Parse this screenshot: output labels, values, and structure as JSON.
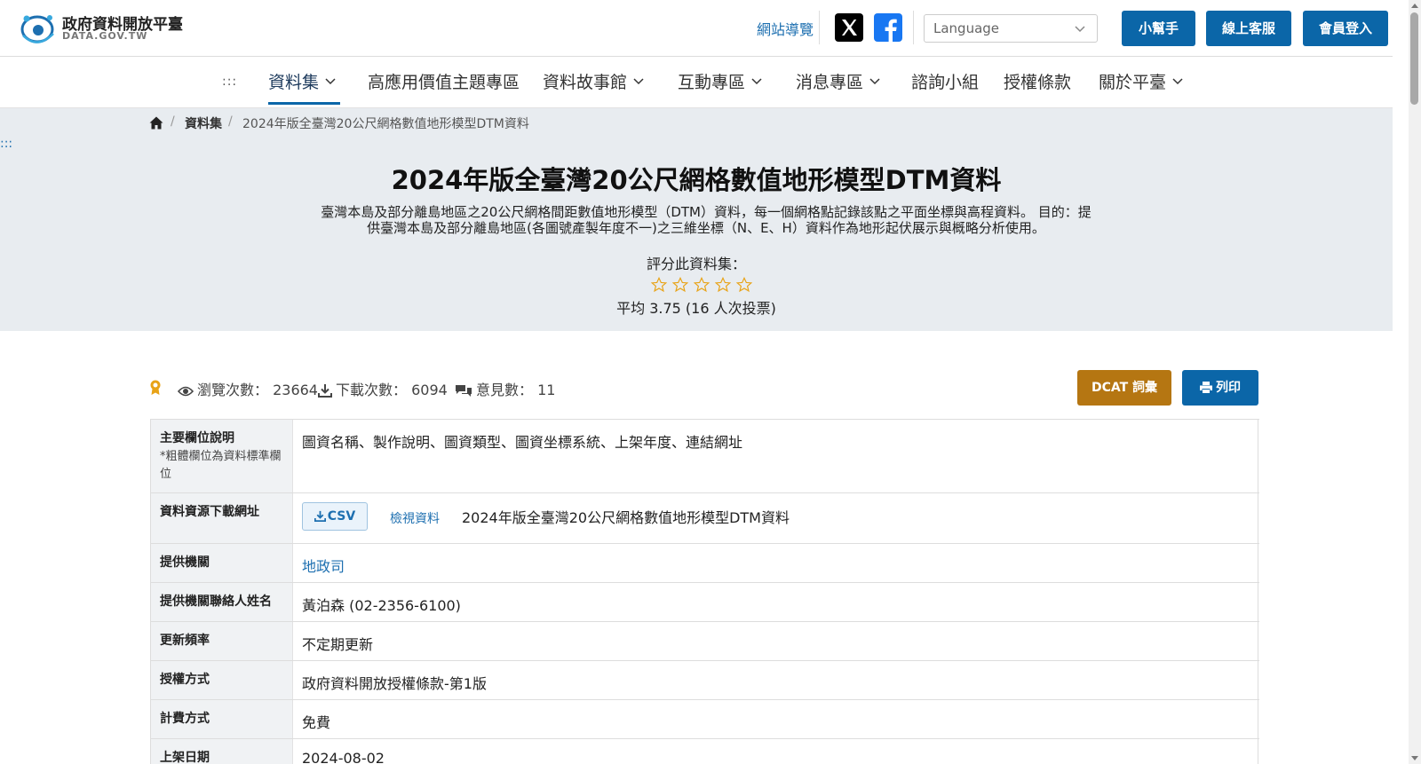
{
  "header": {
    "logo_title": "政府資料開放平臺",
    "logo_sub": "DATA.GOV.TW",
    "sitemap_label": "網站導覽",
    "language_placeholder": "Language",
    "buttons": {
      "helper": "小幫手",
      "service": "線上客服",
      "login": "會員登入"
    }
  },
  "nav": {
    "marker": ":::",
    "items": [
      {
        "label": "資料集"
      },
      {
        "label": "高應用價值主題專區"
      },
      {
        "label": "資料故事館"
      },
      {
        "label": "互動專區"
      },
      {
        "label": "消息專區"
      },
      {
        "label": "諮詢小組"
      },
      {
        "label": "授權條款"
      },
      {
        "label": "關於平臺"
      }
    ]
  },
  "breadcrumb": {
    "side_marker": ":::",
    "items": [
      "資料集",
      "2024年版全臺灣20公尺網格數值地形模型DTM資料"
    ]
  },
  "dataset": {
    "title": "2024年版全臺灣20公尺網格數值地形模型DTM資料",
    "description": "臺灣本島及部分離島地區之20公尺網格間距數值地形模型（DTM）資料，每一個網格點記錄該點之平面坐標與高程資料。 目的：提供臺灣本島及部分離島地區(各圖號產製年度不一)之三維坐標（N、E、H）資料作為地形起伏展示與概略分析使用。",
    "rate_label": "評分此資料集：",
    "rating_average_text": "平均 3.75 (16 人次投票)",
    "rating_stars_total": 5
  },
  "stats": {
    "views": "瀏覽次數： 23664",
    "downloads": "下載次數： 6094",
    "comments": "意見數： 11",
    "dcat_label": "DCAT 詞彙",
    "print_label": "列印"
  },
  "info": {
    "fields_key": "主要欄位說明",
    "fields_note": "*粗體欄位為資料標準欄位",
    "fields_value": "圖資名稱、製作說明、圖資類型、圖資坐標系統、上架年度、連結網址",
    "resource_key": "資料資源下載網址",
    "csv_label": "CSV",
    "view_label": "檢視資料",
    "resource_name": "2024年版全臺灣20公尺網格數值地形模型DTM資料",
    "provider_key": "提供機關",
    "provider_value": "地政司",
    "contact_key": "提供機關聯絡人姓名",
    "contact_value": "黃泊森 (02-2356-6100)",
    "frequency_key": "更新頻率",
    "frequency_value": "不定期更新",
    "license_key": "授權方式",
    "license_value": "政府資料開放授權條款-第1版",
    "fee_key": "計費方式",
    "fee_value": "免費",
    "published_key": "上架日期",
    "published_value": "2024-08-02"
  },
  "colors": {
    "primary": "#0b66a8",
    "dcat": "#b57612",
    "link": "#1d6fb0",
    "hero_bg": "#e8ecf0",
    "star": "#e8a317"
  }
}
